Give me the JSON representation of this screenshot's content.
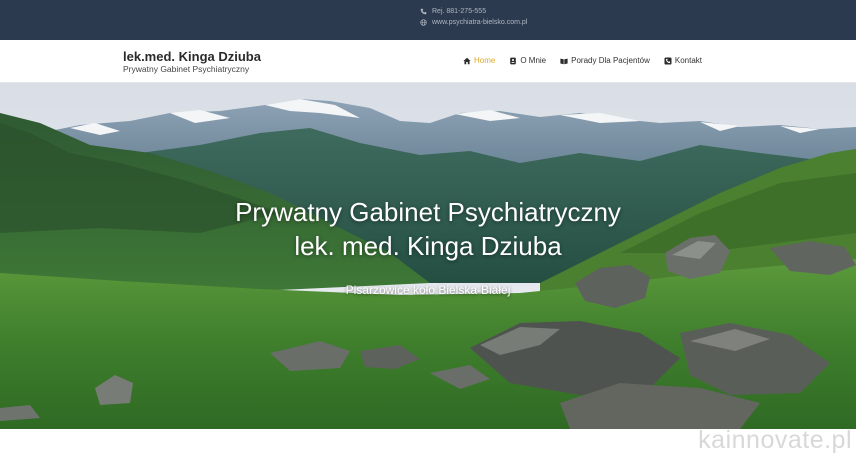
{
  "topbar": {
    "phone": "Rej. 881-275-555",
    "website": "www.psychiatra-bielsko.com.pl"
  },
  "brand": {
    "name": "lek.med. Kinga Dziuba",
    "subtitle": "Prywatny Gabinet Psychiatryczny"
  },
  "nav": {
    "items": [
      {
        "label": "Home",
        "icon": "home-icon",
        "active": true
      },
      {
        "label": "O Mnie",
        "icon": "contact-card-icon",
        "active": false
      },
      {
        "label": "Porady Dla Pacjentów",
        "icon": "book-icon",
        "active": false
      },
      {
        "label": "Kontakt",
        "icon": "phone-icon",
        "active": false
      }
    ]
  },
  "hero": {
    "title_line1": "Prywatny Gabinet Psychiatryczny",
    "title_line2": "lek. med. Kinga Dziuba",
    "subtitle": "Pisarzowice koło Bielska-Białej"
  },
  "watermark": "kainnovate.pl",
  "colors": {
    "topbar_bg": "#2c3a4f",
    "accent": "#e0a92b",
    "text_dark": "#2a2a2a"
  }
}
